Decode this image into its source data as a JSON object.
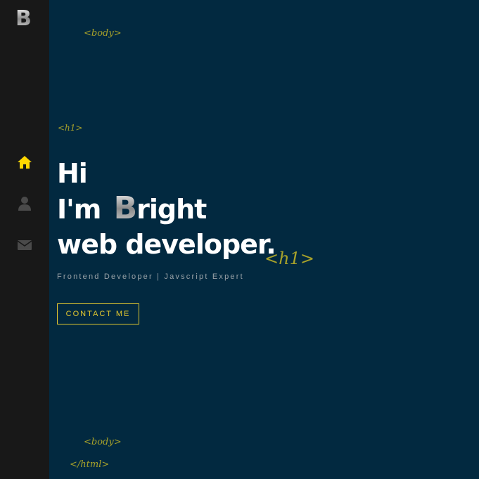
{
  "sidebar": {
    "logo_letter": "B",
    "nav": [
      {
        "name": "home",
        "icon": "home-icon",
        "active": true,
        "color": "#ffd700"
      },
      {
        "name": "about",
        "icon": "user-icon",
        "active": false,
        "color": "#4a4a4a"
      },
      {
        "name": "contact",
        "icon": "envelope-icon",
        "active": false,
        "color": "#4a4a4a"
      }
    ]
  },
  "tags": {
    "body_open": "<body>",
    "h1_open": "<h1>",
    "h1_close": "<h1>",
    "body_close": "<body>",
    "html_close": "</html>"
  },
  "hero": {
    "line1": "Hi",
    "line2_prefix": "I'm",
    "line2_logo": "B",
    "line2_suffix": "right",
    "line3": "web developer.",
    "subtitle": "Frontend Developer | Javscript Expert",
    "cta_label": "CONTACT ME"
  },
  "colors": {
    "background": "#022940",
    "sidebar": "#181818",
    "accent": "#e1c72f",
    "tag": "#a8a22a"
  }
}
